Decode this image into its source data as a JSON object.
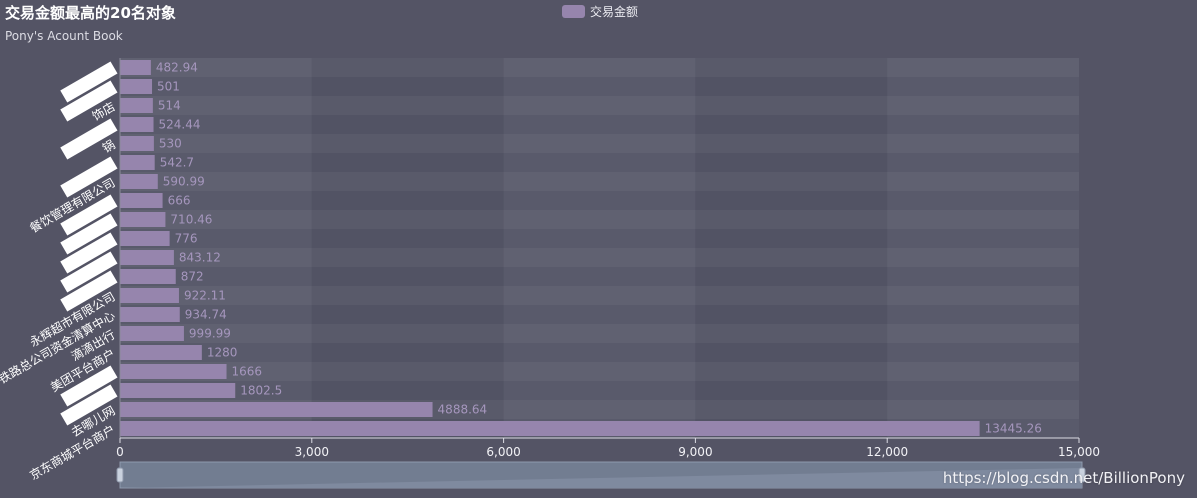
{
  "chart_data": {
    "type": "bar",
    "orientation": "horizontal",
    "title": "交易金额最高的20名对象",
    "subtitle": "Pony's Acount Book",
    "legend": [
      "交易金额"
    ],
    "series": [
      {
        "name": "交易金额",
        "values": [
          482.94,
          501,
          514,
          524.44,
          530,
          542.7,
          590.99,
          666,
          710.46,
          776,
          843.12,
          872,
          922.11,
          934.74,
          999.99,
          1280,
          1666,
          1802.5,
          4888.64,
          13445.26
        ]
      }
    ],
    "categories": [
      "",
      "",
      "饰店",
      "",
      "锅",
      "",
      "餐饮管理有限公司",
      "",
      "",
      "",
      "",
      "",
      "永辉超市有限公司",
      "铁路总公司资金清算中心",
      "滴滴出行",
      "美团平台商户",
      "",
      "",
      "去哪儿网",
      "京东商城平台商户"
    ],
    "x_ticks": [
      "0",
      "3,000",
      "6,000",
      "9,000",
      "12,000",
      "15,000"
    ],
    "xlim": [
      0,
      15000
    ],
    "colors": {
      "bar": "#9685ad",
      "bar_label": "#a596bd",
      "background": "#545465"
    },
    "datazoom": true
  },
  "watermark": "https://blog.csdn.net/BillionPony"
}
